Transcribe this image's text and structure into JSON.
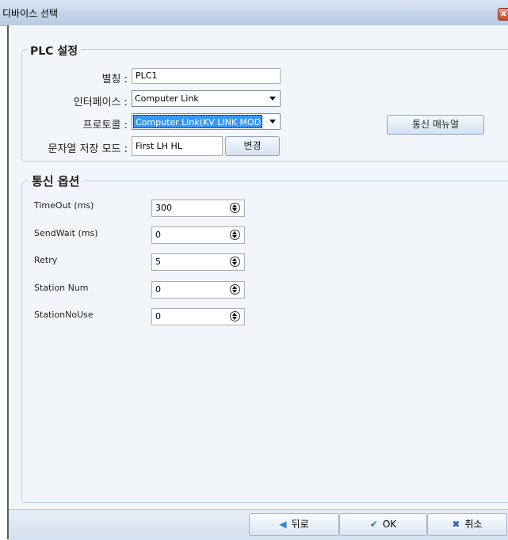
{
  "window": {
    "title": "디바이스 선택",
    "close_glyph": "x"
  },
  "plc": {
    "legend": "PLC 설정",
    "alias_label": "별칭 :",
    "alias_value": "PLC1",
    "interface_label": "인터페이스 :",
    "interface_value": "Computer Link",
    "protocol_label": "프로토콜 :",
    "protocol_value": "Computer Link(KV LINK MODE",
    "string_mode_label": "문자열 저장 모드 :",
    "string_mode_value": "First LH HL",
    "change_button": "변경",
    "manual_button": "통신 매뉴얼"
  },
  "comm": {
    "legend": "통신 옵션",
    "options": [
      {
        "label": "TimeOut (ms)",
        "value": "300"
      },
      {
        "label": "SendWait (ms)",
        "value": "0"
      },
      {
        "label": "Retry",
        "value": "5"
      },
      {
        "label": "Station Num",
        "value": "0"
      },
      {
        "label": "StationNoUse",
        "value": "0"
      }
    ]
  },
  "footer": {
    "back_label": "뒤로",
    "back_icon": "arrow-left-icon",
    "ok_label": "OK",
    "ok_icon": "checkmark-icon",
    "cancel_label": "취소",
    "cancel_icon": "x-icon"
  },
  "colors": {
    "accent_blue": "#3399ff",
    "back_arrow": "#2e86d6",
    "ok_check": "#2b6fc4",
    "cancel_x": "#2b5fa8"
  }
}
